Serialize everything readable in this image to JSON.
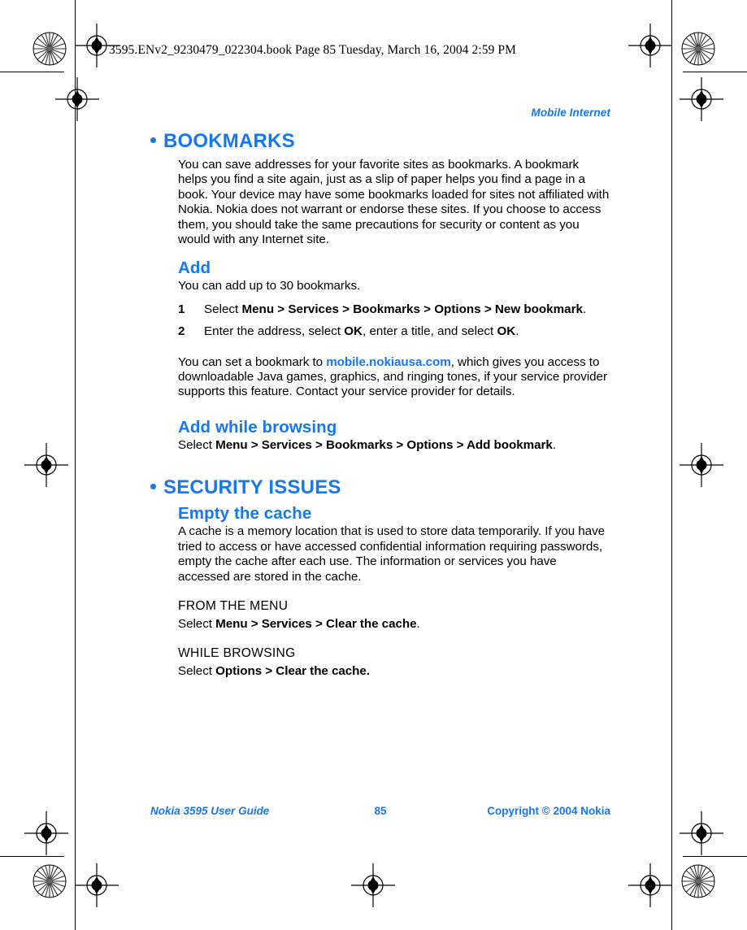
{
  "print_header": "3595.ENv2_9230479_022304.book  Page 85  Tuesday, March 16, 2004  2:59 PM",
  "running_head": "Mobile Internet",
  "sections": [
    {
      "heading": "BOOKMARKS",
      "intro": "You can save addresses for your favorite sites as bookmarks. A bookmark helps you find a site again, just as a slip of paper helps you find a page in a book. Your device may have some bookmarks loaded for sites not affiliated with Nokia. Nokia does not warrant or endorse these sites. If you choose to access them, you should take the same precautions for security or content as you would with any Internet site."
    },
    {
      "heading": "SECURITY ISSUES"
    }
  ],
  "add": {
    "heading": "Add",
    "intro": "You can add up to 30 bookmarks.",
    "steps": [
      {
        "num": "1",
        "lead": "Select ",
        "path": "Menu > Services > Bookmarks > Options > New bookmark",
        "tail": "."
      },
      {
        "num": "2",
        "lead": "Enter the address, select ",
        "bold1": "OK",
        "mid": ", enter a title, and select ",
        "bold2": "OK",
        "tail": "."
      }
    ],
    "note_lead": "You can set a bookmark to ",
    "note_link": "mobile.nokiausa.com",
    "note_tail": ", which gives you access to downloadable Java games, graphics, and ringing tones, if your service provider supports this feature. Contact your service provider for details."
  },
  "add_while_browsing": {
    "heading": "Add while browsing",
    "lead": "Select ",
    "path": "Menu > Services > Bookmarks > Options > Add bookmark",
    "tail": "."
  },
  "empty_cache": {
    "heading": "Empty the cache",
    "body": "A cache is a memory location that is used to store data temporarily. If you have tried to access or have accessed confidential information requiring passwords, empty the cache after each use. The information or services you have accessed are stored in the cache.",
    "from_menu": {
      "heading": "FROM THE MENU",
      "lead": "Select ",
      "path": "Menu > Services > Clear the cache",
      "tail": "."
    },
    "while_browsing": {
      "heading": "WHILE BROWSING",
      "lead": "Select ",
      "path": "Options > Clear the cache.",
      "tail": ""
    }
  },
  "footer": {
    "left": "Nokia 3595 User Guide",
    "page_number": "85",
    "right": "Copyright © 2004 Nokia"
  },
  "colors": {
    "accent_blue": "#1478f0",
    "text_black": "#000000",
    "page_background": "#ffffff"
  }
}
